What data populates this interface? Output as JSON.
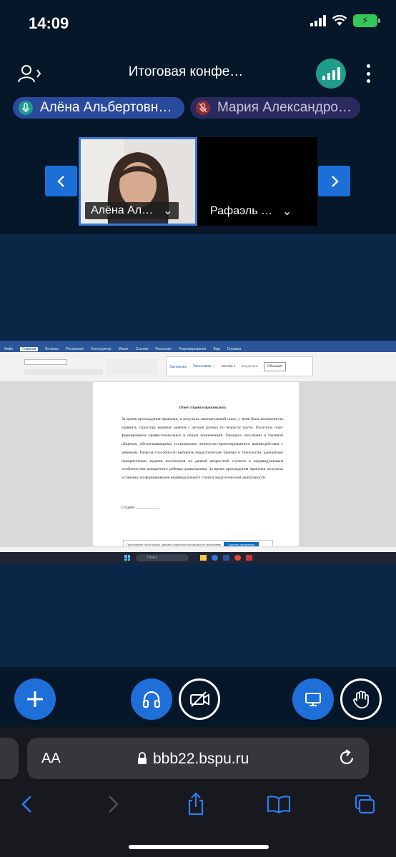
{
  "status_bar": {
    "time": "14:09",
    "battery_icon": "charging-battery-icon"
  },
  "header": {
    "title": "Итоговая конфе…"
  },
  "participants_pills": [
    {
      "name": "Алёна Альбертовн…",
      "mic": "mic-on"
    },
    {
      "name": "Мария Александро…",
      "mic": "mic-muted"
    }
  ],
  "video_tiles": [
    {
      "name": "Алёна Ал…"
    },
    {
      "name": "Рафаэль …"
    }
  ],
  "shared_document": {
    "ribbon_tabs": [
      "Файл",
      "Главная",
      "Вставка",
      "Рисование",
      "Конструктор",
      "Макет",
      "Ссылки",
      "Рассылки",
      "Рецензирование",
      "Вид",
      "Справка"
    ],
    "styles": [
      "Заголово",
      "Заголовок…",
      "Заголов 3",
      "Выделение",
      "Обычный"
    ],
    "title": "Отчет студента-практиканта",
    "body": "За время прохождения практики, я получила замечательный опыт, у меня была возможность сравнить структуру ведения занятия с детьми разных по возрасту групп. Получила опыт формирования профессиональных и общих компетенций. Овладела способами и тактикой общения, обеспечивающими установление личностно-ориентированного взаимодействия с ребенком. Развила способности выбирать педагогические приемы и технологии, адекватные приоритетным задачам воспитания на данной возрастной ступени и индивидуальным особенностям конкретного ребенка-дошкольника. За время прохождения практики получила установку на формирование индивидуального стиля в педагогической деятельности.",
    "signature": "Студент ____________",
    "notification": "Приложение Word можно сделать средством просмотра по умолчанию",
    "notification_button": "Сделать средством",
    "taskbar_search": "Поиск"
  },
  "address_bar": {
    "aa": "AA",
    "url": "bbb22.bspu.ru"
  }
}
